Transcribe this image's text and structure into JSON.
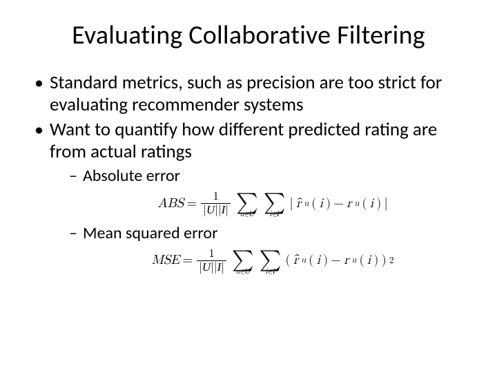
{
  "title": "Evaluating Collaborative Filtering",
  "bullets": {
    "b1": "Standard metrics, such as precision are too strict for evaluating recommender systems",
    "b2": "Want to quantify how different predicted rating are from actual ratings",
    "sub1": "Absolute error",
    "sub2": "Mean squared error"
  },
  "formulas": {
    "abs": {
      "lhs": "ABS",
      "eq": "=",
      "frac_num": "1",
      "frac_den_U": "U",
      "frac_den_I": "I",
      "sum1_sub_pre": "u∈",
      "sum1_sub_set": "U",
      "sum2_sub_pre": "i∈",
      "sum2_sub_set": "I",
      "bar_l": "|",
      "rhat": "r̂",
      "r_sub": "u",
      "r_arg_open": "(",
      "r_arg_i": "i",
      "r_arg_close": ")",
      "minus": "−",
      "r": "r",
      "bar_r": "|"
    },
    "mse": {
      "lhs": "MSE",
      "eq": "=",
      "frac_num": "1",
      "frac_den_U": "U",
      "frac_den_I": "I",
      "sum1_sub_pre": "u∈",
      "sum1_sub_set": "U",
      "sum2_sub_pre": "i∈",
      "sum2_sub_set": "I",
      "paren_l": "(",
      "rhat": "r̂",
      "r_sub": "u",
      "r_arg_open": "(",
      "r_arg_i": "i",
      "r_arg_close": ")",
      "minus": "−",
      "r": "r",
      "paren_r": ")",
      "exp": "2"
    }
  }
}
